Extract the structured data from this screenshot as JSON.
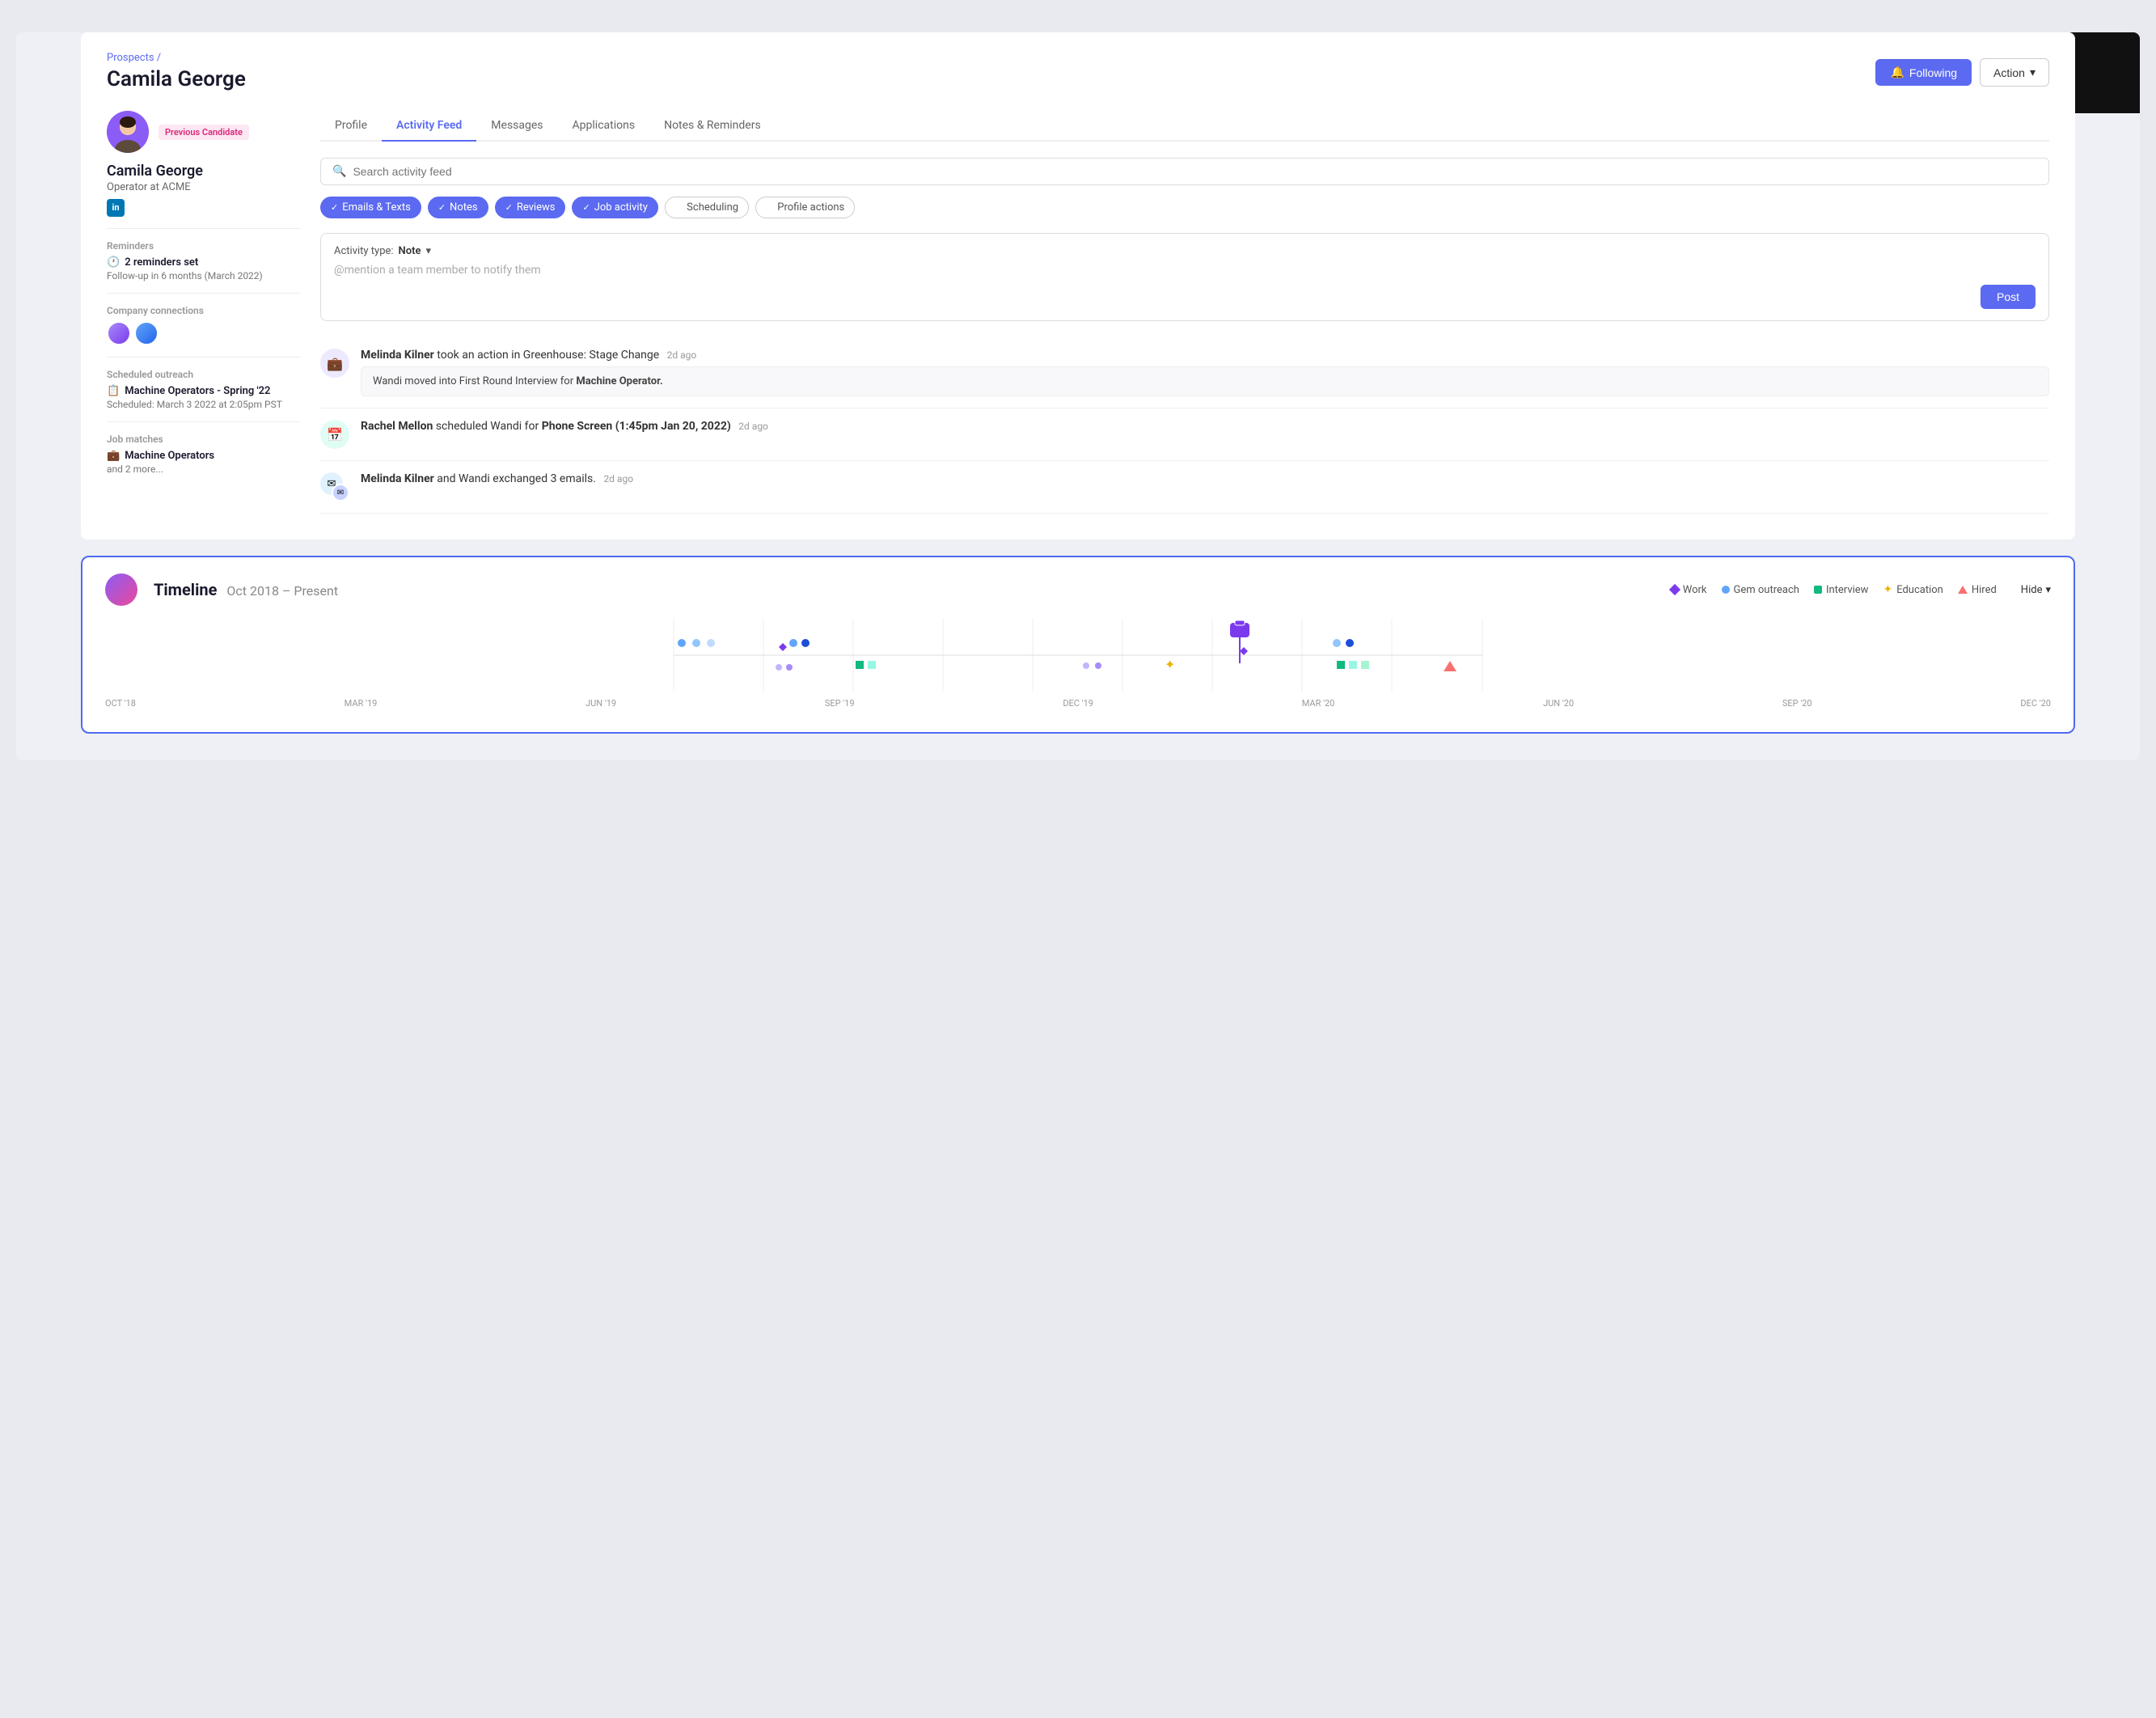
{
  "breadcrumb": "Prospects /",
  "page_title": "Camila George",
  "header_actions": {
    "following_label": "Following",
    "action_label": "Action"
  },
  "left_panel": {
    "badge": "Previous Candidate",
    "name": "Camila George",
    "title": "Operator at ACME",
    "reminders_label": "Reminders",
    "reminders_count": "2 reminders set",
    "reminders_sub": "Follow-up in 6 months (March 2022)",
    "connections_label": "Company connections",
    "outreach_label": "Scheduled outreach",
    "outreach_name": "Machine Operators - Spring '22",
    "outreach_sub": "Scheduled: March 3 2022 at 2:05pm PST",
    "job_matches_label": "Job matches",
    "job_match_name": "Machine Operators",
    "job_match_more": "and 2 more..."
  },
  "tabs": [
    {
      "id": "profile",
      "label": "Profile"
    },
    {
      "id": "activity-feed",
      "label": "Activity Feed"
    },
    {
      "id": "messages",
      "label": "Messages"
    },
    {
      "id": "applications",
      "label": "Applications"
    },
    {
      "id": "notes-reminders",
      "label": "Notes & Reminders"
    }
  ],
  "active_tab": "activity-feed",
  "search_placeholder": "Search activity feed",
  "filter_chips": [
    {
      "id": "emails",
      "label": "Emails & Texts",
      "active": true
    },
    {
      "id": "notes",
      "label": "Notes",
      "active": true
    },
    {
      "id": "reviews",
      "label": "Reviews",
      "active": true
    },
    {
      "id": "job-activity",
      "label": "Job activity",
      "active": true
    },
    {
      "id": "scheduling",
      "label": "Scheduling",
      "active": false
    },
    {
      "id": "profile-actions",
      "label": "Profile actions",
      "active": false
    }
  ],
  "note_area": {
    "type_label": "Activity type:",
    "type_value": "Note",
    "placeholder": "@mention a team member to notify them",
    "post_button": "Post"
  },
  "feed_items": [
    {
      "id": 1,
      "icon": "briefcase",
      "icon_type": "purple",
      "actor": "Melinda Kilner",
      "action": " took an action in Greenhouse: Stage Change",
      "time": "2d ago",
      "sub": "Wandi moved into First Round Interview for Machine Operator."
    },
    {
      "id": 2,
      "icon": "calendar",
      "icon_type": "teal",
      "actor": "Rachel Mellon",
      "action": " scheduled Wandi for ",
      "highlight": "Phone Screen (1:45pm Jan 20, 2022)",
      "time": "2d ago",
      "sub": null
    },
    {
      "id": 3,
      "icon": "email-multi",
      "icon_type": "multi",
      "actor": "Melinda Kilner",
      "action": " and Wandi exchanged 3 emails.",
      "time": "2d ago",
      "sub": null
    }
  ],
  "timeline": {
    "title": "Timeline",
    "range": "Oct 2018 – Present",
    "legend": [
      {
        "id": "work",
        "label": "Work",
        "color": "#7c3aed",
        "shape": "diamond"
      },
      {
        "id": "gem-outreach",
        "label": "Gem outreach",
        "color": "#60a5fa",
        "shape": "circle"
      },
      {
        "id": "interview",
        "label": "Interview",
        "color": "#10b981",
        "shape": "square"
      },
      {
        "id": "education",
        "label": "Education",
        "color": "#eab308",
        "shape": "star"
      },
      {
        "id": "hired",
        "label": "Hired",
        "color": "#f87171",
        "shape": "triangle"
      }
    ],
    "hide_label": "Hide",
    "months": [
      "OCT '18",
      "MAR '19",
      "JUN '19",
      "SEP '19",
      "DEC '19",
      "MAR '20",
      "JUN '20",
      "SEP '20",
      "DEC '20"
    ]
  }
}
